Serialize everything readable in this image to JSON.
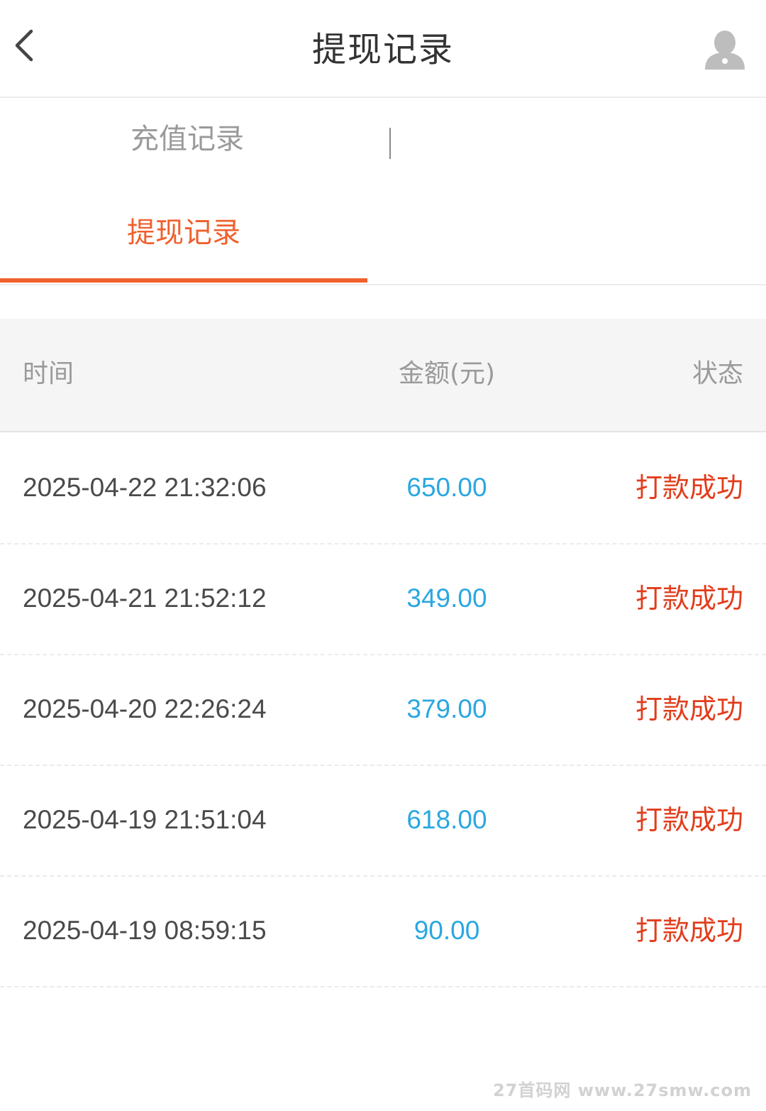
{
  "header": {
    "title": "提现记录"
  },
  "tabs": [
    {
      "label": "充值记录",
      "active": false
    },
    {
      "label": "提现记录",
      "active": true
    }
  ],
  "table": {
    "columns": [
      "时间",
      "金额(元)",
      "状态"
    ],
    "rows": [
      {
        "time": "2025-04-22 21:32:06",
        "amount": "650.00",
        "status": "打款成功"
      },
      {
        "time": "2025-04-21 21:52:12",
        "amount": "349.00",
        "status": "打款成功"
      },
      {
        "time": "2025-04-20 22:26:24",
        "amount": "379.00",
        "status": "打款成功"
      },
      {
        "time": "2025-04-19 21:51:04",
        "amount": "618.00",
        "status": "打款成功"
      },
      {
        "time": "2025-04-19 08:59:15",
        "amount": "90.00",
        "status": "打款成功"
      }
    ]
  },
  "watermark": "27首码网 www.27smw.com",
  "colors": {
    "accent": "#f0602d",
    "amount": "#2aa7e0",
    "status_success": "#e23d1c",
    "muted": "#9a9a9a"
  },
  "icons": {
    "back": "chevron-left-icon",
    "user": "user-silhouette-icon"
  }
}
